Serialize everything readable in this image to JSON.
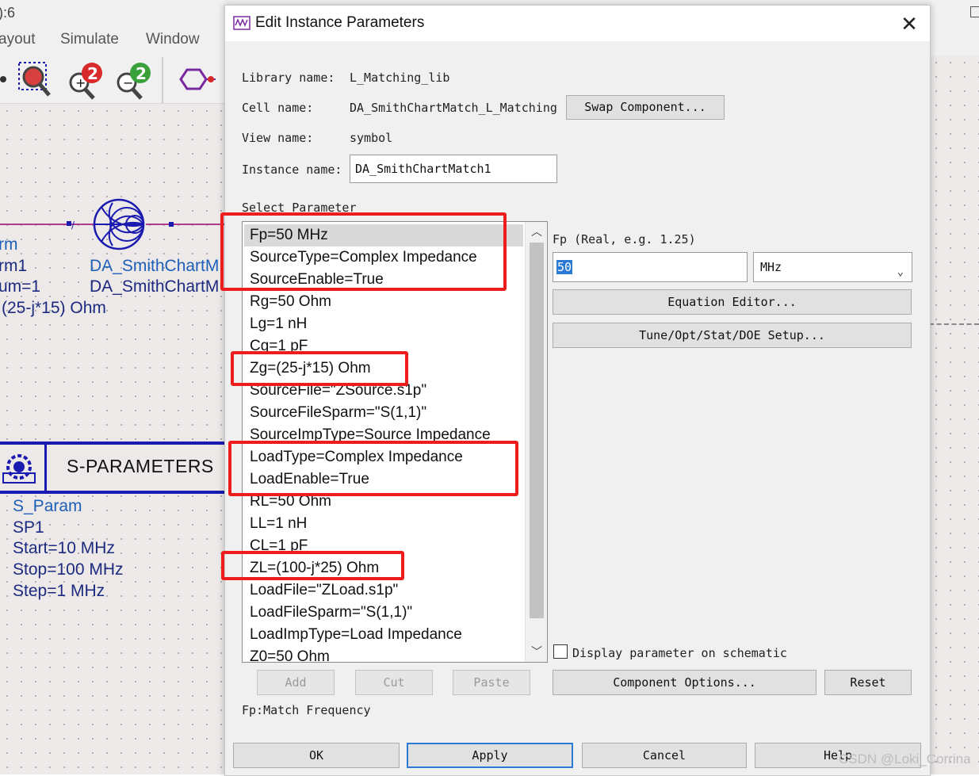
{
  "background": {
    "title_fragment": "):6",
    "menu": [
      "ayout",
      "Simulate",
      "Window"
    ],
    "schematic": {
      "term_label": "rm",
      "term_name": "rm1",
      "term_num": "um=1",
      "term_z": "(25-j*15) Ohm",
      "smith_label_1": "DA_SmithChartM",
      "smith_label_2": "DA_SmithChartM",
      "sparam_title": "S-PARAMETERS",
      "sp_type": "S_Param",
      "sp_name": "SP1",
      "sp_start": "Start=10 MHz",
      "sp_stop": "Stop=100 MHz",
      "sp_step": "Step=1 MHz"
    }
  },
  "dialog": {
    "title": "Edit Instance Parameters",
    "library_label": "Library name:",
    "library_value": "L_Matching_lib",
    "cell_label": "Cell name:",
    "cell_value": "DA_SmithChartMatch_L_Matching",
    "swap_button": "Swap Component...",
    "view_label": "View name:",
    "view_value": "symbol",
    "instance_label": "Instance name:",
    "instance_value": "DA_SmithChartMatch1",
    "select_param_label": "Select Parameter",
    "parameters": [
      "Fp=50 MHz",
      "SourceType=Complex Impedance",
      "SourceEnable=True",
      "Rg=50 Ohm",
      "Lg=1 nH",
      "Cg=1 pF",
      "Zg=(25-j*15) Ohm",
      "SourceFile=\"ZSource.s1p\"",
      "SourceFileSparm=\"S(1,1)\"",
      "SourceImpType=Source Impedance",
      "LoadType=Complex Impedance",
      "LoadEnable=True",
      "RL=50 Ohm",
      "LL=1 nH",
      "CL=1 pF",
      "ZL=(100-j*25) Ohm",
      "LoadFile=\"ZLoad.s1p\"",
      "LoadFileSparm=\"S(1,1)\"",
      "LoadImpType=Load Impedance",
      "Z0=50 Ohm"
    ],
    "selected_index": 0,
    "param_hint": "Fp (Real, e.g. 1.25)",
    "value_input": "50",
    "unit_select": "MHz",
    "equation_editor_button": "Equation Editor...",
    "tune_button": "Tune/Opt/Stat/DOE Setup...",
    "display_checkbox_label": "Display parameter on schematic",
    "display_checked": false,
    "add_button": "Add",
    "cut_button": "Cut",
    "paste_button": "Paste",
    "component_options_button": "Component Options...",
    "reset_button": "Reset",
    "description": "Fp:Match Frequency",
    "ok_button": "OK",
    "apply_button": "Apply",
    "cancel_button": "Cancel",
    "help_button": "Help"
  },
  "watermark": "CSDN @Loki_Corrina",
  "colors": {
    "highlight_box": "#ee1c1c",
    "schematic_text": "#1f5fb8",
    "wire": "#b0398b",
    "selection": "#2b7ad6"
  }
}
